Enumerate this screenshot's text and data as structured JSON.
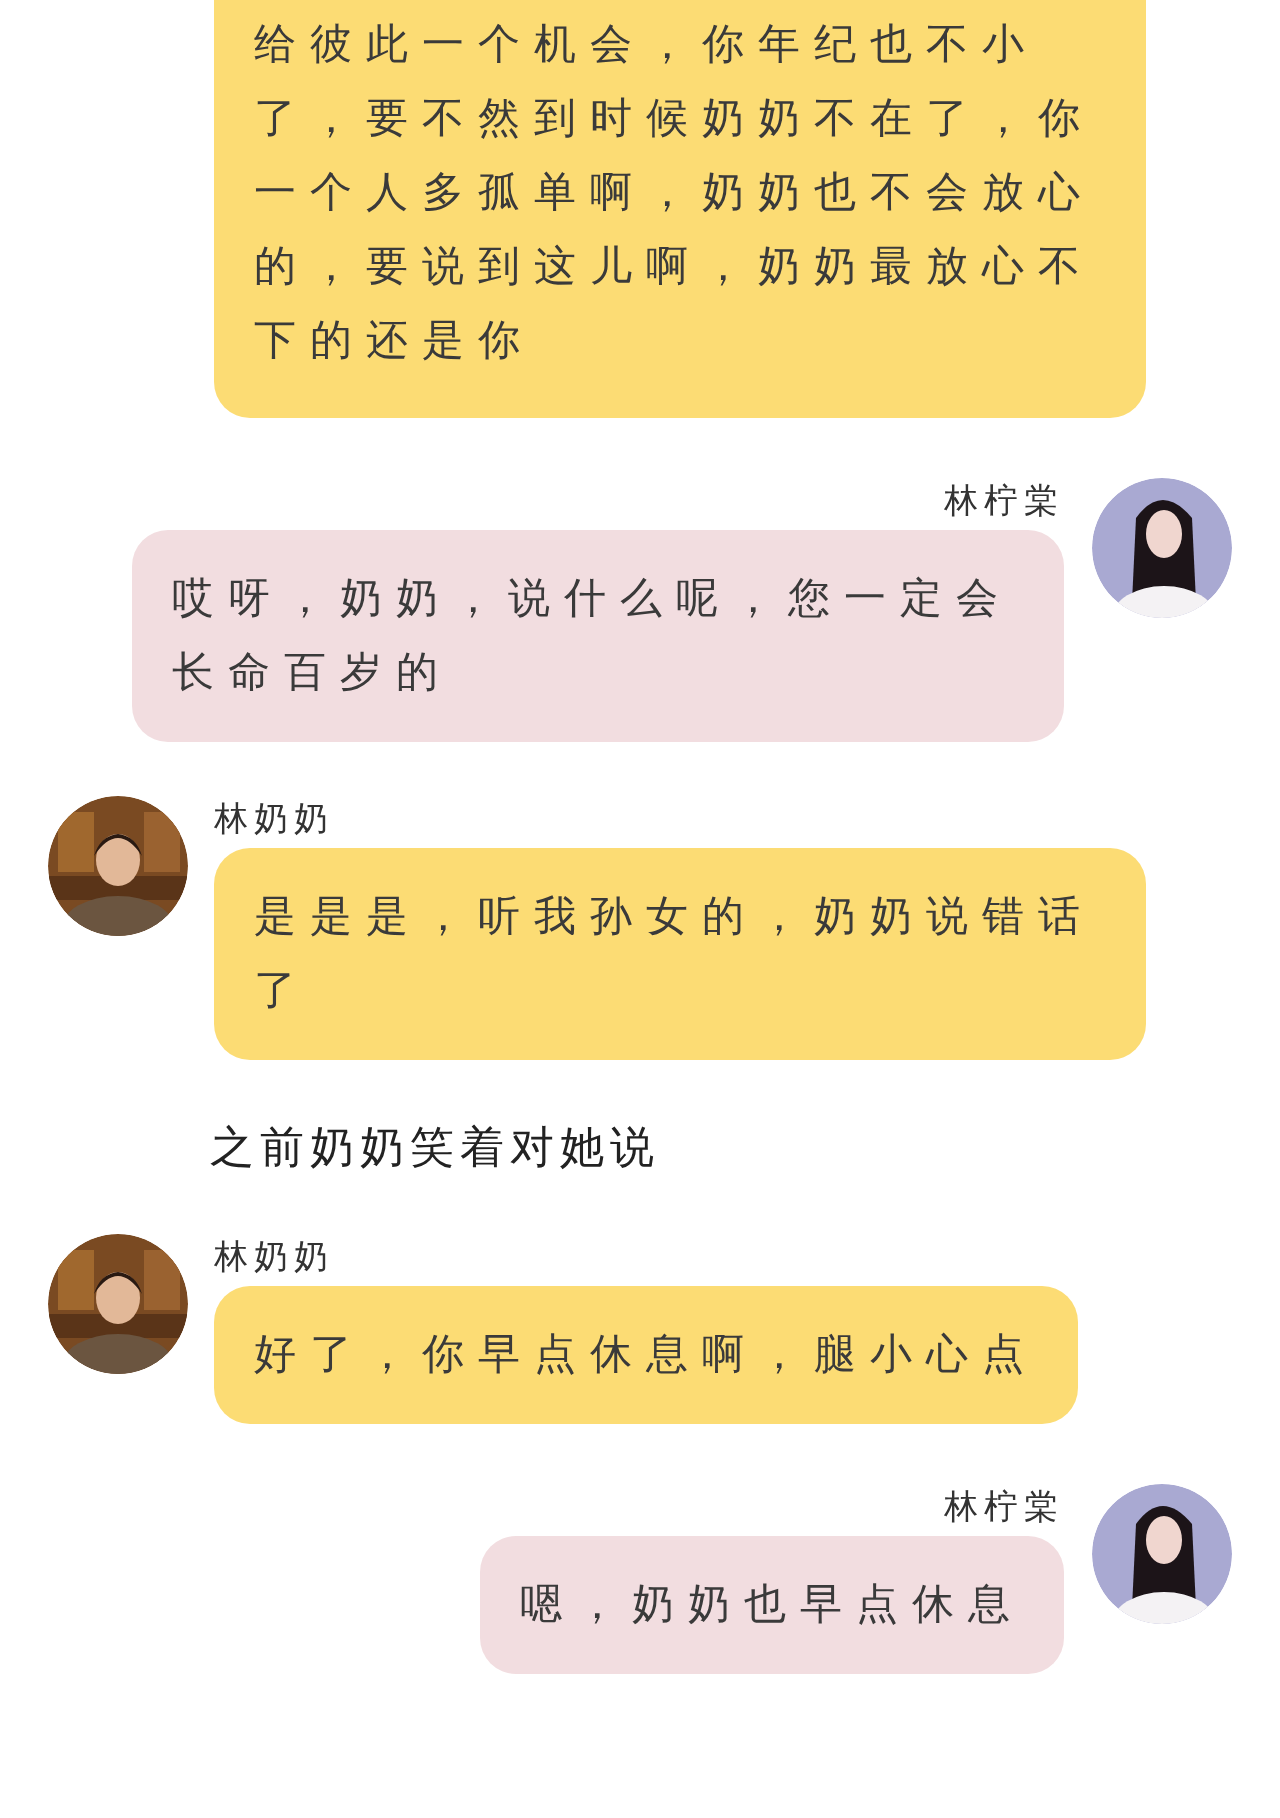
{
  "messages": [
    {
      "kind": "incoming",
      "continued": true,
      "text": "给彼此一个机会，你年纪也不小了，要不然到时候奶奶不在了，你一个人多孤单啊，奶奶也不会放心的，要说到这儿啊，奶奶最放心不下的还是你"
    },
    {
      "kind": "outgoing",
      "sender": "林柠棠",
      "text": "哎呀，奶奶，说什么呢，您一定会长命百岁的"
    },
    {
      "kind": "incoming",
      "sender": "林奶奶",
      "text": "是是是，听我孙女的，奶奶说错话了"
    },
    {
      "kind": "narration",
      "text": "之前奶奶笑着对她说"
    },
    {
      "kind": "incoming",
      "sender": "林奶奶",
      "text": "好了，你早点休息啊，腿小心点"
    },
    {
      "kind": "outgoing",
      "sender": "林柠棠",
      "text": "嗯，奶奶也早点休息"
    }
  ]
}
